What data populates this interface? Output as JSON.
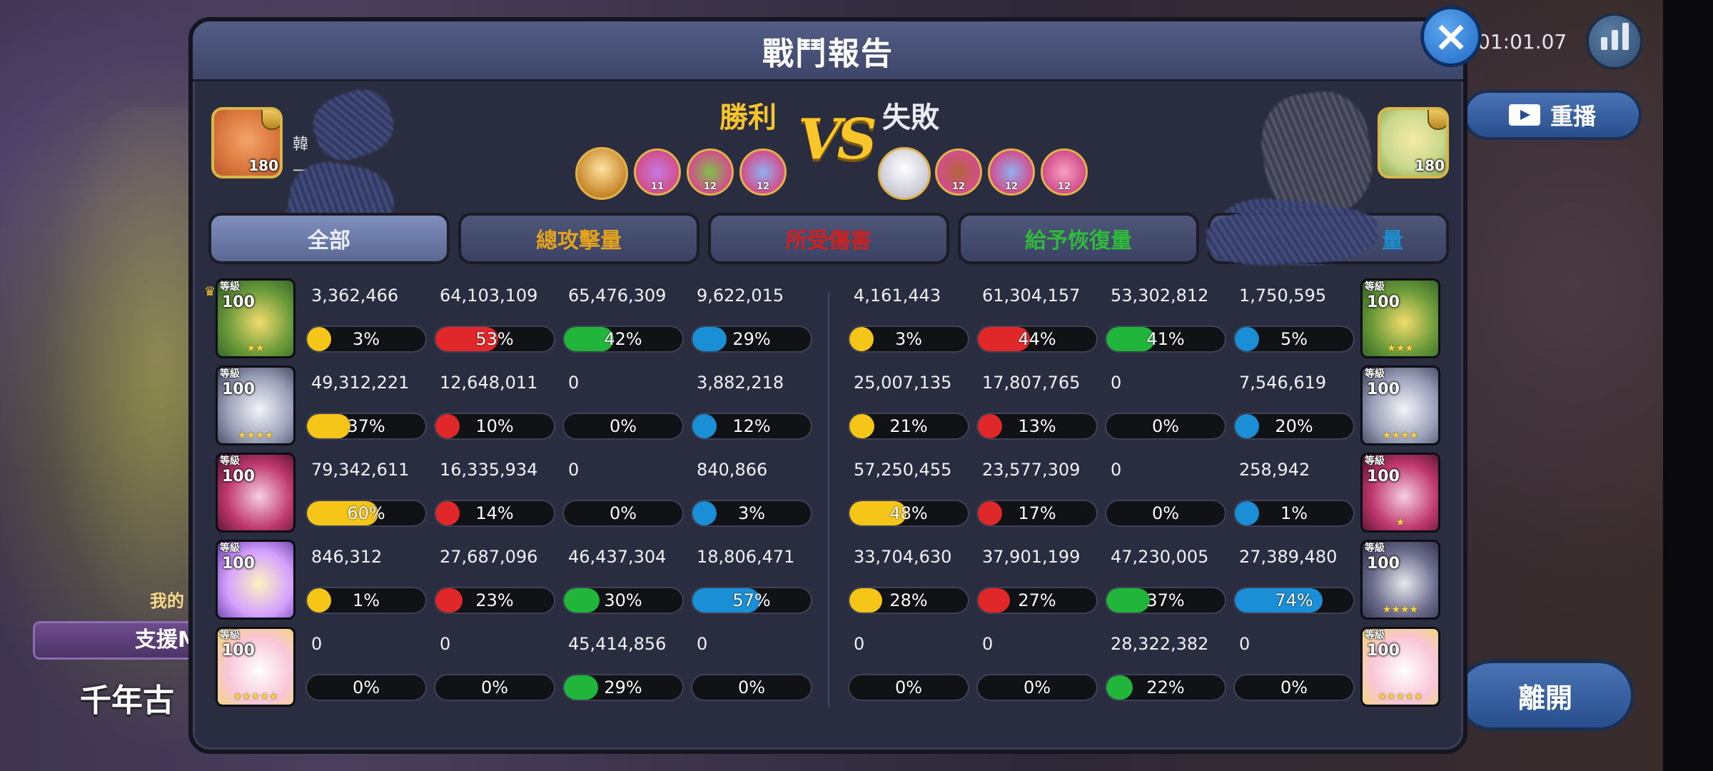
{
  "modal": {
    "title": "戰鬥報告",
    "close_label": "×"
  },
  "hud": {
    "timer": "01:01.07",
    "replay_label": "重播",
    "leave_label": "離開"
  },
  "background": {
    "sub_label": "我的",
    "banner_label": "支援M",
    "bottom_text": "千年古"
  },
  "left_player": {
    "level": "180",
    "name_partial": "韓",
    "sub_partial": "一"
  },
  "right_player": {
    "level": "180"
  },
  "result": {
    "left": "勝利",
    "vs": "VS",
    "right": "失敗"
  },
  "teams": {
    "left": [
      {
        "level": ""
      },
      {
        "level": "11"
      },
      {
        "level": "12"
      },
      {
        "level": "12"
      }
    ],
    "right": [
      {
        "level": ""
      },
      {
        "level": "12"
      },
      {
        "level": "12"
      },
      {
        "level": "12"
      }
    ]
  },
  "tabs": [
    {
      "label": "全部"
    },
    {
      "label": "總攻擊量"
    },
    {
      "label": "所受傷害"
    },
    {
      "label": "給予恢復量"
    },
    {
      "label": "量"
    }
  ],
  "cookie_tag": "等級",
  "rows": [
    {
      "left": {
        "level": "100",
        "stars": "★★",
        "stats": [
          {
            "value": "3,362,466",
            "pct": 3
          },
          {
            "value": "64,103,109",
            "pct": 53
          },
          {
            "value": "65,476,309",
            "pct": 42
          },
          {
            "value": "9,622,015",
            "pct": 29
          }
        ]
      },
      "right": {
        "level": "100",
        "stars": "★★★",
        "stats": [
          {
            "value": "4,161,443",
            "pct": 3
          },
          {
            "value": "61,304,157",
            "pct": 44
          },
          {
            "value": "53,302,812",
            "pct": 41
          },
          {
            "value": "1,750,595",
            "pct": 5
          }
        ]
      }
    },
    {
      "left": {
        "level": "100",
        "stars": "★★★★",
        "stats": [
          {
            "value": "49,312,221",
            "pct": 37
          },
          {
            "value": "12,648,011",
            "pct": 10
          },
          {
            "value": "0",
            "pct": 0
          },
          {
            "value": "3,882,218",
            "pct": 12
          }
        ]
      },
      "right": {
        "level": "100",
        "stars": "★★★★",
        "stats": [
          {
            "value": "25,007,135",
            "pct": 21
          },
          {
            "value": "17,807,765",
            "pct": 13
          },
          {
            "value": "0",
            "pct": 0
          },
          {
            "value": "7,546,619",
            "pct": 20
          }
        ]
      }
    },
    {
      "left": {
        "level": "100",
        "stars": "",
        "stats": [
          {
            "value": "79,342,611",
            "pct": 60
          },
          {
            "value": "16,335,934",
            "pct": 14
          },
          {
            "value": "0",
            "pct": 0
          },
          {
            "value": "840,866",
            "pct": 3
          }
        ]
      },
      "right": {
        "level": "100",
        "stars": "★",
        "stats": [
          {
            "value": "57,250,455",
            "pct": 48
          },
          {
            "value": "23,577,309",
            "pct": 17
          },
          {
            "value": "0",
            "pct": 0
          },
          {
            "value": "258,942",
            "pct": 1
          }
        ]
      }
    },
    {
      "left": {
        "level": "100",
        "stars": "",
        "stats": [
          {
            "value": "846,312",
            "pct": 1
          },
          {
            "value": "27,687,096",
            "pct": 23
          },
          {
            "value": "46,437,304",
            "pct": 30
          },
          {
            "value": "18,806,471",
            "pct": 57
          }
        ]
      },
      "right": {
        "level": "100",
        "stars": "★★★★",
        "stats": [
          {
            "value": "33,704,630",
            "pct": 28
          },
          {
            "value": "37,901,199",
            "pct": 27
          },
          {
            "value": "47,230,005",
            "pct": 37
          },
          {
            "value": "27,389,480",
            "pct": 74
          }
        ]
      }
    },
    {
      "left": {
        "level": "100",
        "stars": "★★★★★",
        "stats": [
          {
            "value": "0",
            "pct": 0
          },
          {
            "value": "0",
            "pct": 0
          },
          {
            "value": "45,414,856",
            "pct": 29
          },
          {
            "value": "0",
            "pct": 0
          }
        ]
      },
      "right": {
        "level": "100",
        "stars": "★★★★★",
        "stats": [
          {
            "value": "0",
            "pct": 0
          },
          {
            "value": "0",
            "pct": 0
          },
          {
            "value": "28,322,382",
            "pct": 22
          },
          {
            "value": "0",
            "pct": 0
          }
        ]
      }
    }
  ],
  "colors": {
    "heal": "#f5c518",
    "attack": "#e0282a",
    "recover": "#22b53b",
    "shield": "#1a8fd6",
    "win": "#f8c52a"
  }
}
